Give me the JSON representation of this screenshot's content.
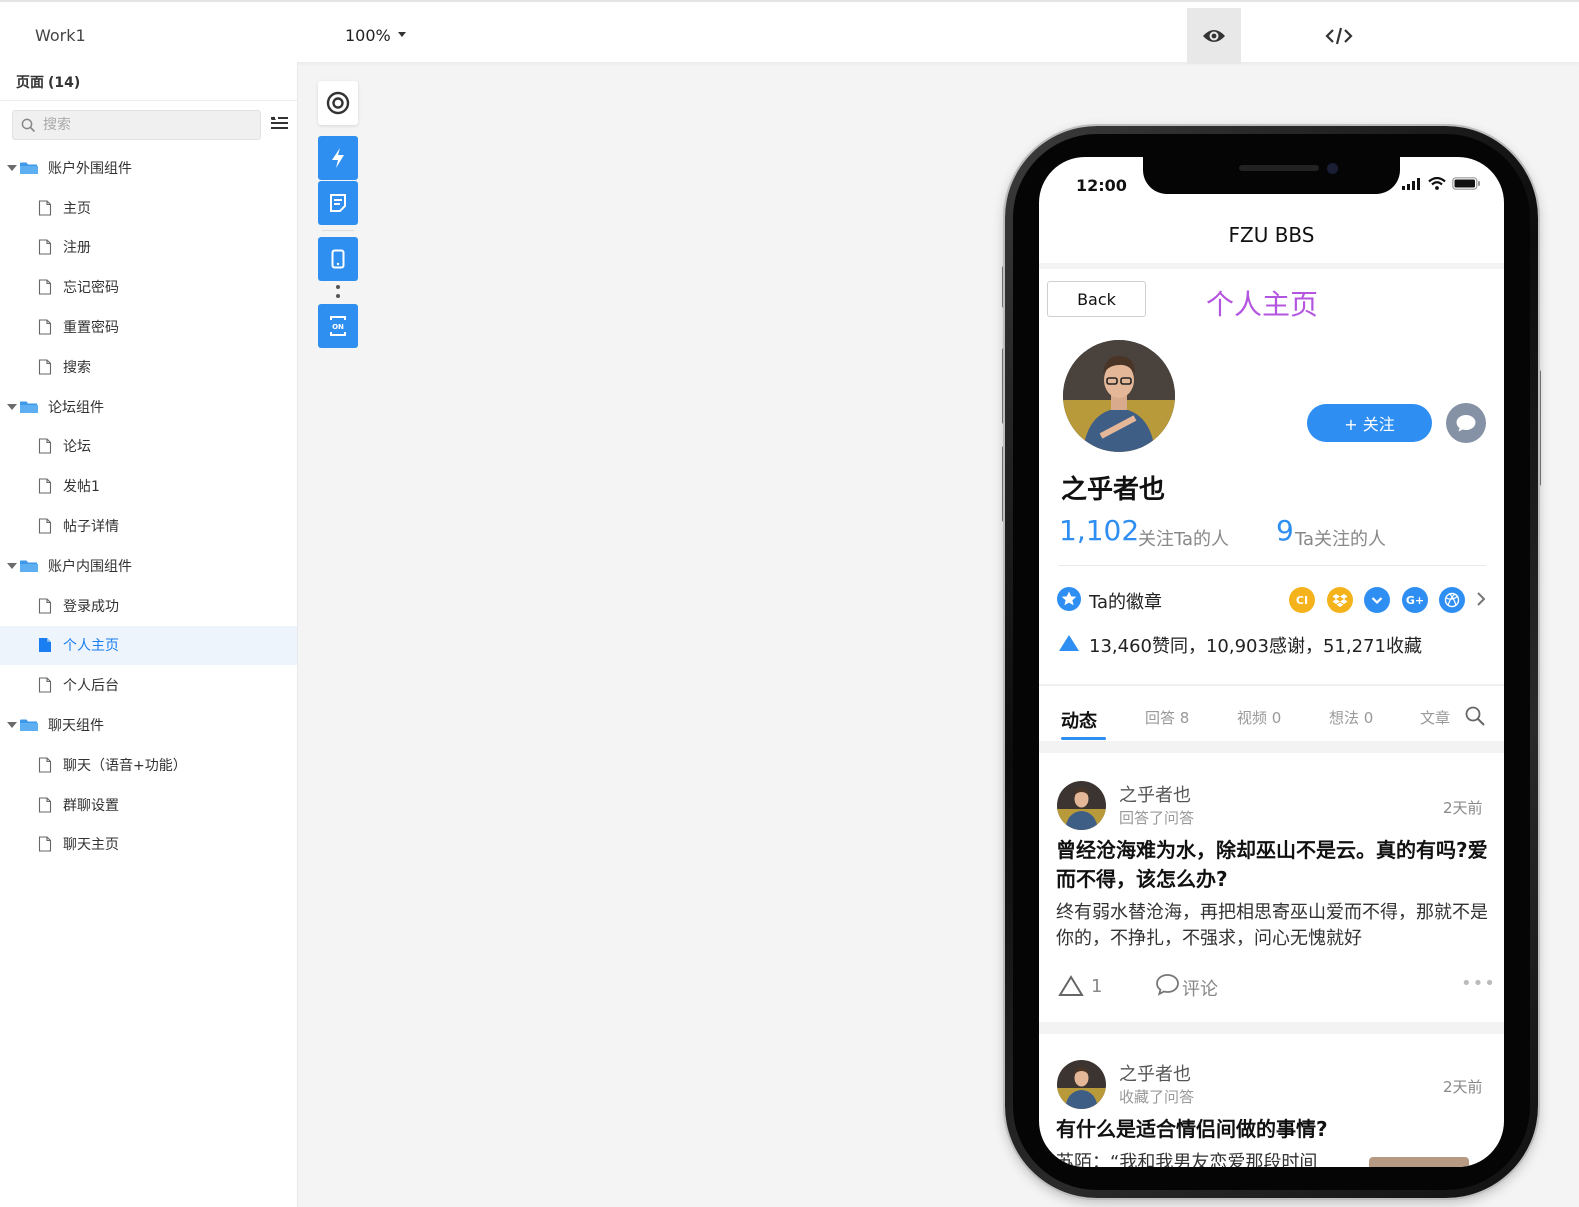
{
  "app": {
    "project_name": "Work1",
    "zoom": "100%"
  },
  "sidebar": {
    "title": "页面",
    "count": "(14)",
    "search_placeholder": "搜索",
    "tree": [
      {
        "type": "folder",
        "label": "账户外围组件"
      },
      {
        "type": "page",
        "label": "主页"
      },
      {
        "type": "page",
        "label": "注册"
      },
      {
        "type": "page",
        "label": "忘记密码"
      },
      {
        "type": "page",
        "label": "重置密码"
      },
      {
        "type": "page",
        "label": "搜索"
      },
      {
        "type": "folder",
        "label": "论坛组件"
      },
      {
        "type": "page",
        "label": "论坛"
      },
      {
        "type": "page",
        "label": "发帖1"
      },
      {
        "type": "page",
        "label": "帖子详情"
      },
      {
        "type": "folder",
        "label": "账户内围组件"
      },
      {
        "type": "page",
        "label": "登录成功"
      },
      {
        "type": "page",
        "label": "个人主页",
        "active": true
      },
      {
        "type": "page",
        "label": "个人后台"
      },
      {
        "type": "folder",
        "label": "聊天组件"
      },
      {
        "type": "page",
        "label": "聊天（语音+功能）"
      },
      {
        "type": "page",
        "label": "群聊设置"
      },
      {
        "type": "page",
        "label": "聊天主页"
      }
    ]
  },
  "tools": [
    "target-icon",
    "lightning-icon",
    "note-icon",
    "mobile-icon",
    "json-icon"
  ],
  "phone": {
    "status_time": "12:00",
    "nav_title": "FZU BBS",
    "back_label": "Back",
    "page_heading": "个人主页",
    "username": "之乎者也",
    "follow_label": "+ 关注",
    "followers_count": "1,102",
    "followers_label": "关注Ta的人",
    "following_count": "9",
    "following_label": "Ta关注的人",
    "badges_label": "Ta的徽章",
    "badges": [
      {
        "icon": "ci-badge",
        "text": "CI",
        "color": "#f5b31b"
      },
      {
        "icon": "dropbox-badge",
        "text": "",
        "color": "#f5b31b"
      },
      {
        "icon": "chevron-badge",
        "text": "",
        "color": "#2e8ef2"
      },
      {
        "icon": "google-plus-badge",
        "text": "G+",
        "color": "#2e8ef2"
      },
      {
        "icon": "dribbble-badge",
        "text": "",
        "color": "#2e8ef2"
      }
    ],
    "likes_text": "13,460赞同，10,903感谢，51,271收藏",
    "tabs": [
      "动态",
      "回答 8",
      "视频 0",
      "想法 0",
      "文章"
    ],
    "feed": [
      {
        "author": "之乎者也",
        "action": "回答了问答",
        "time": "2天前",
        "title": "曾经沧海难为水，除却巫山不是云。真的有吗?爱而不得，该怎么办?",
        "body": "终有弱水替沧海，再把相思寄巫山爱而不得，那就不是你的，不挣扎，不强求，问心无愧就好",
        "up_count": "1",
        "comment_label": "评论",
        "more": "•••"
      },
      {
        "author": "之乎者也",
        "action": "收藏了问答",
        "time": "2天前",
        "title": "有什么是适合情侣间做的事情?",
        "body": "苏陌：“我和我男友恋爱那段时间"
      }
    ]
  },
  "colors": {
    "accent": "#2e8ef2",
    "heading_purple": "#b455e0",
    "active_row_bg": "#eef4fc"
  }
}
